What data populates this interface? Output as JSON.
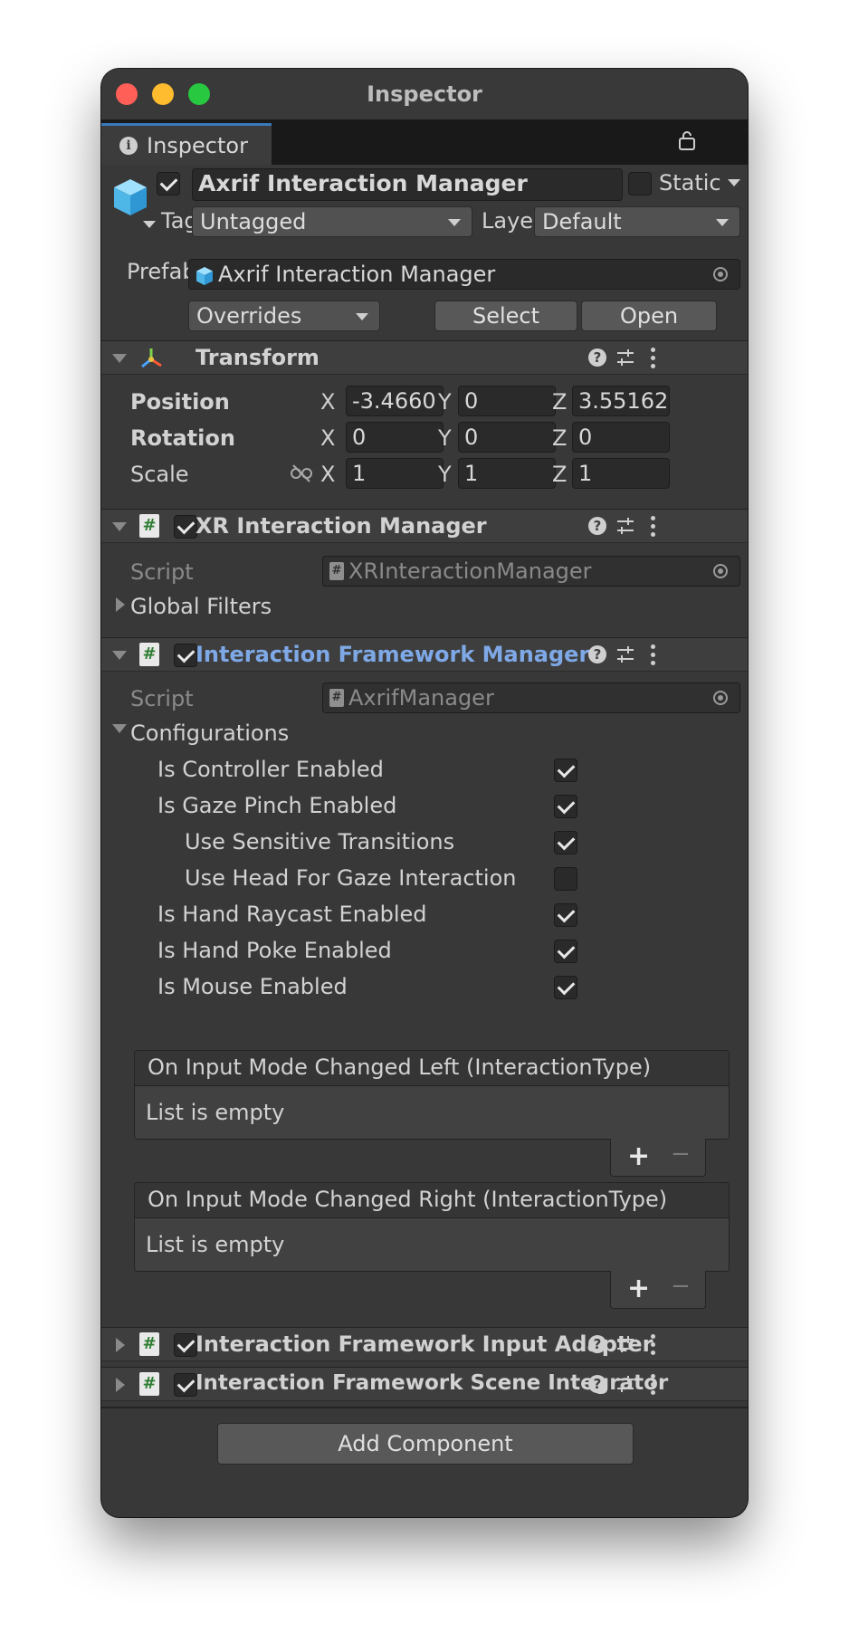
{
  "window": {
    "title": "Inspector"
  },
  "tab": {
    "label": "Inspector"
  },
  "object": {
    "name": "Axrif Interaction Manager",
    "active": true,
    "static_label": "Static",
    "static": false,
    "tag_label": "Tag",
    "tag_value": "Untagged",
    "layer_label": "Layer",
    "layer_value": "Default"
  },
  "prefab": {
    "label": "Prefab",
    "value": "Axrif Interaction Manager",
    "overrides_label": "Overrides",
    "select_label": "Select",
    "open_label": "Open"
  },
  "transform": {
    "title": "Transform",
    "position_label": "Position",
    "rotation_label": "Rotation",
    "scale_label": "Scale",
    "axis_x": "X",
    "axis_y": "Y",
    "axis_z": "Z",
    "position": {
      "x": "-3.4660",
      "y": "0",
      "z": "3.55162"
    },
    "rotation": {
      "x": "0",
      "y": "0",
      "z": "0"
    },
    "scale": {
      "x": "1",
      "y": "1",
      "z": "1"
    }
  },
  "xr_manager": {
    "title": "XR Interaction Manager",
    "enabled": true,
    "script_label": "Script",
    "script_value": "XRInteractionManager",
    "global_filters_label": "Global Filters"
  },
  "framework_manager": {
    "title": "Interaction Framework Manager",
    "enabled": true,
    "script_label": "Script",
    "script_value": "AxrifManager",
    "configurations_label": "Configurations",
    "options": [
      {
        "label": "Is Controller Enabled",
        "checked": true
      },
      {
        "label": "Is Gaze Pinch Enabled",
        "checked": true
      },
      {
        "label": "Use Sensitive Transitions",
        "checked": true
      },
      {
        "label": "Use Head For Gaze Interaction",
        "checked": false
      },
      {
        "label": "Is Hand Raycast Enabled",
        "checked": true
      },
      {
        "label": "Is Hand Poke Enabled",
        "checked": true
      },
      {
        "label": "Is Mouse Enabled",
        "checked": true
      }
    ],
    "events": [
      {
        "title": "On Input Mode Changed Left (InteractionType)",
        "body": "List is empty"
      },
      {
        "title": "On Input Mode Changed Right (InteractionType)",
        "body": "List is empty"
      }
    ],
    "plus": "+",
    "minus": "−"
  },
  "input_adapter": {
    "title": "Interaction Framework Input Adapter",
    "enabled": true
  },
  "scene_integrator": {
    "title": "Interaction Framework Scene Integrator",
    "enabled": true
  },
  "add_component_label": "Add Component",
  "colors": {
    "accent_blue": "#7ea8e6",
    "tab_accent": "#3a79bb",
    "close": "#ff5f57",
    "minimize": "#febc2e",
    "maximize": "#28c840"
  }
}
